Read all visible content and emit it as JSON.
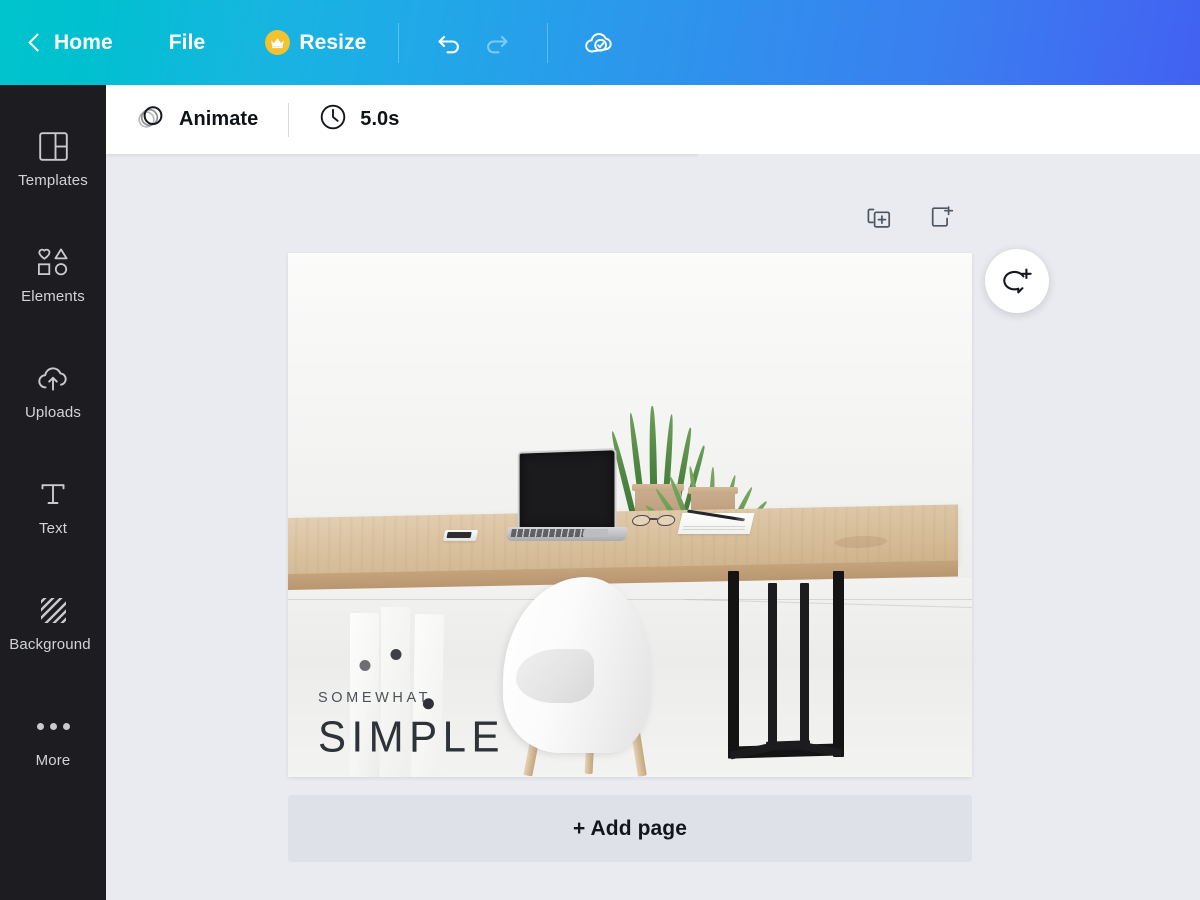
{
  "header": {
    "back_icon": "chevron-left-icon",
    "home_label": "Home",
    "file_label": "File",
    "resize_label": "Resize",
    "resize_badge_icon": "crown-icon",
    "undo_icon": "undo-arrow-icon",
    "redo_icon": "redo-arrow-icon",
    "save_status_icon": "cloud-check-icon",
    "gradient_start": "#00c4cc",
    "gradient_end": "#4261f2",
    "crown_color": "#f2c230"
  },
  "sidebar": {
    "background": "#1d1d21",
    "items": [
      {
        "label": "Templates",
        "icon": "templates-layout-icon"
      },
      {
        "label": "Elements",
        "icon": "elements-shapes-icon"
      },
      {
        "label": "Uploads",
        "icon": "cloud-upload-icon"
      },
      {
        "label": "Text",
        "icon": "text-t-icon"
      },
      {
        "label": "Background",
        "icon": "background-hatch-icon"
      },
      {
        "label": "More",
        "icon": "more-dots-icon"
      }
    ]
  },
  "toolbar": {
    "animate_label": "Animate",
    "animate_icon": "animate-circles-icon",
    "duration_label": "5.0s",
    "duration_icon": "clock-icon"
  },
  "page_tools": {
    "duplicate_page_icon": "duplicate-page-icon",
    "add_page_icon": "add-page-icon"
  },
  "comment": {
    "icon": "comment-add-icon"
  },
  "canvas": {
    "background": "#eaebf0",
    "add_page_label": "+ Add page"
  },
  "design": {
    "headline_small": "SOMEWHAT",
    "headline_large": "SIMPLE",
    "text_color_small": "#4c5258",
    "text_color_large": "#2d3338",
    "photo_subject": "minimal-desk-workspace-photo"
  }
}
